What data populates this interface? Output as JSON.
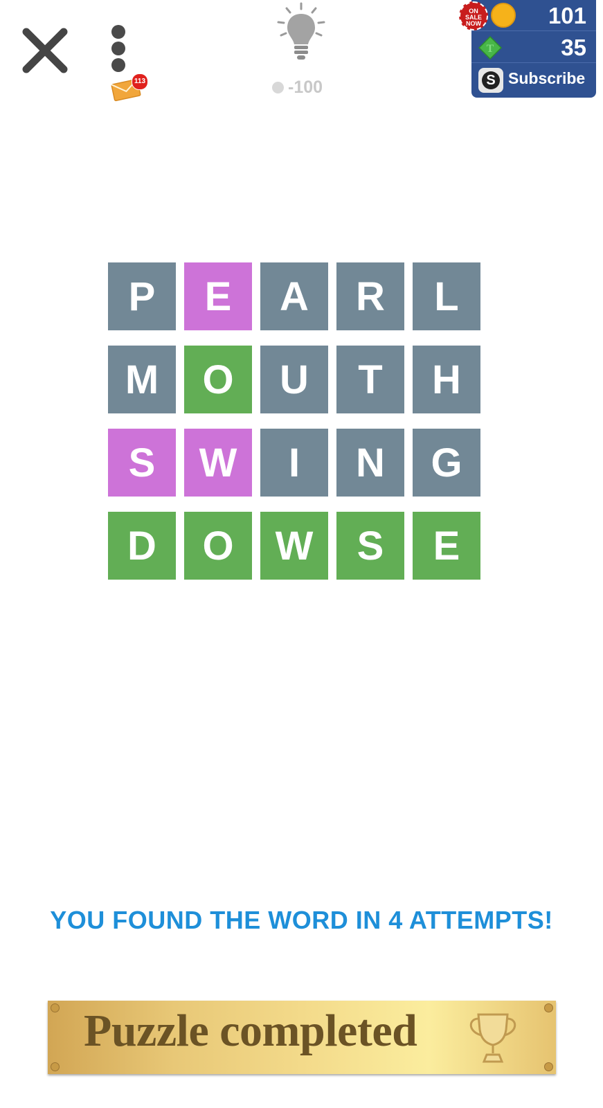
{
  "header": {
    "mail_count": "113",
    "hint_cost": "-100"
  },
  "currency": {
    "sale_badge": "ON SALE NOW",
    "coins": "101",
    "tokens": "35",
    "subscribe_label": "Subscribe"
  },
  "board": {
    "colors": {
      "gray": "#728896",
      "pink": "#cd73d8",
      "green": "#62ae55"
    },
    "rows": [
      {
        "tiles": [
          {
            "letter": "P",
            "state": "gray"
          },
          {
            "letter": "E",
            "state": "pink"
          },
          {
            "letter": "A",
            "state": "gray"
          },
          {
            "letter": "R",
            "state": "gray"
          },
          {
            "letter": "L",
            "state": "gray"
          }
        ]
      },
      {
        "tiles": [
          {
            "letter": "M",
            "state": "gray"
          },
          {
            "letter": "O",
            "state": "green"
          },
          {
            "letter": "U",
            "state": "gray"
          },
          {
            "letter": "T",
            "state": "gray"
          },
          {
            "letter": "H",
            "state": "gray"
          }
        ]
      },
      {
        "tiles": [
          {
            "letter": "S",
            "state": "pink"
          },
          {
            "letter": "W",
            "state": "pink"
          },
          {
            "letter": "I",
            "state": "gray"
          },
          {
            "letter": "N",
            "state": "gray"
          },
          {
            "letter": "G",
            "state": "gray"
          }
        ]
      },
      {
        "tiles": [
          {
            "letter": "D",
            "state": "green"
          },
          {
            "letter": "O",
            "state": "green"
          },
          {
            "letter": "W",
            "state": "green"
          },
          {
            "letter": "S",
            "state": "green"
          },
          {
            "letter": "E",
            "state": "green"
          }
        ]
      }
    ]
  },
  "message": "YOU FOUND THE WORD IN 4 ATTEMPTS!",
  "plaque": {
    "label": "Puzzle completed"
  }
}
